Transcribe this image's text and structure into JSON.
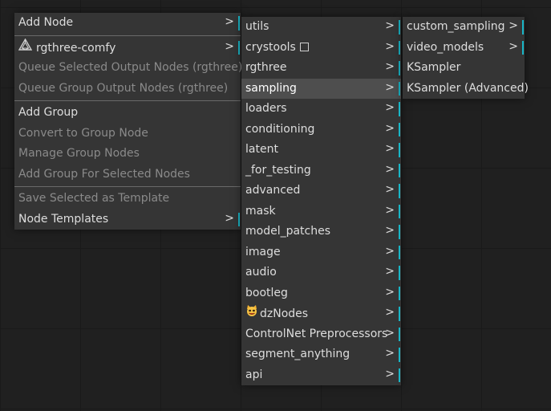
{
  "context_menu": {
    "add_node": "Add Node",
    "rgthree_comfy": "rgthree-comfy",
    "queue_selected_output": "Queue Selected Output Nodes (rgthree)",
    "queue_group_output": "Queue Group Output Nodes (rgthree)",
    "add_group": "Add Group",
    "convert_to_group_node": "Convert to Group Node",
    "manage_group_nodes": "Manage Group Nodes",
    "add_group_for_selected": "Add Group For Selected Nodes",
    "save_selected_as_template": "Save Selected as Template",
    "node_templates": "Node Templates"
  },
  "node_categories": {
    "items": [
      "utils",
      "crystools",
      "rgthree",
      "sampling",
      "loaders",
      "conditioning",
      "latent",
      "_for_testing",
      "advanced",
      "mask",
      "model_patches",
      "image",
      "audio",
      "bootleg",
      "dzNodes",
      "ControlNet Preprocessors",
      "segment_anything",
      "api"
    ],
    "highlighted": "sampling"
  },
  "sampling_submenu": {
    "items": [
      "custom_sampling",
      "video_models",
      "KSampler",
      "KSampler (Advanced)"
    ]
  },
  "arrow_glyph": ">",
  "accent_color": "#19b6c7",
  "icons": {
    "rgthree": "rgthree-logo-icon",
    "dznodes": "cat-emoji-icon",
    "crystools": "square-icon"
  }
}
